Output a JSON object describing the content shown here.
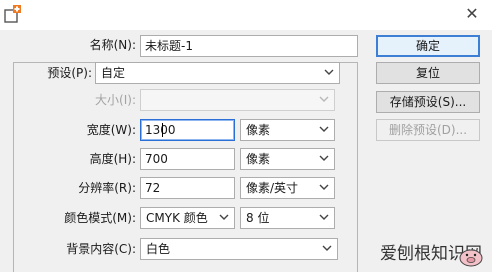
{
  "fields": {
    "name": {
      "label": "名称(N):",
      "value": "未标题-1"
    },
    "preset": {
      "label": "预设(P):",
      "value": "自定"
    },
    "size": {
      "label": "大小(I):",
      "value": ""
    },
    "width": {
      "label": "宽度(W):",
      "value": "1300",
      "unit": "像素"
    },
    "height": {
      "label": "高度(H):",
      "value": "700",
      "unit": "像素"
    },
    "resolution": {
      "label": "分辨率(R):",
      "value": "72",
      "unit": "像素/英寸"
    },
    "color_mode": {
      "label": "颜色模式(M):",
      "value": "CMYK 颜色",
      "bits": "8 位"
    },
    "background": {
      "label": "背景内容(C):",
      "value": "白色"
    }
  },
  "buttons": {
    "ok": "确定",
    "reset": "复位",
    "save_preset": "存储预设(S)...",
    "delete_preset": "删除预设(D)..."
  },
  "watermark": {
    "text": "爱刨根知识网"
  },
  "colors": {
    "accent": "#3c7fd4",
    "icon_orange": "#f07a22"
  }
}
